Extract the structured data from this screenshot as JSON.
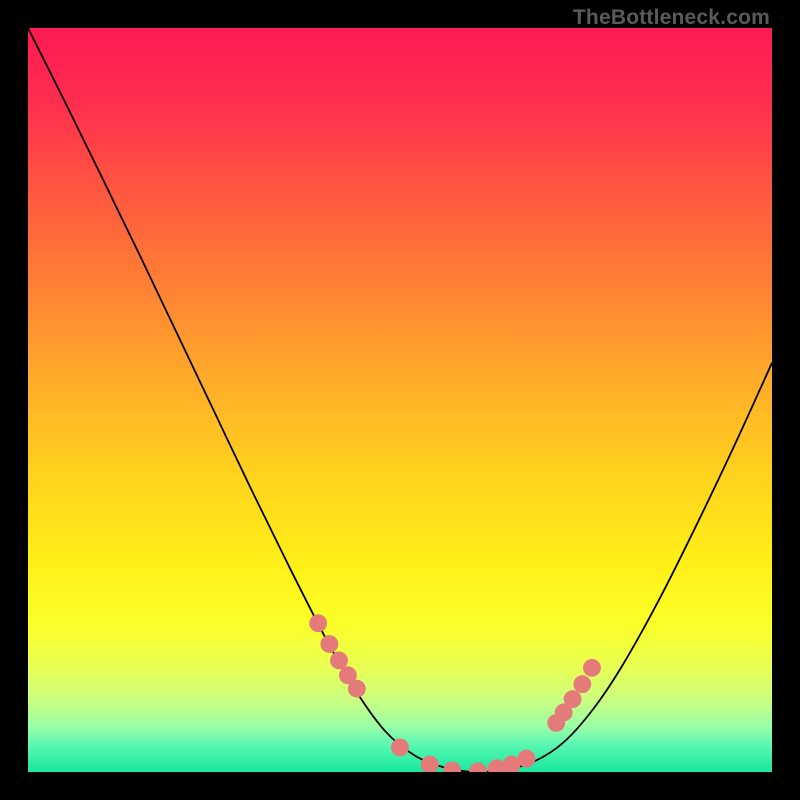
{
  "watermark": "TheBottleneck.com",
  "chart_data": {
    "type": "line",
    "title": "",
    "xlabel": "",
    "ylabel": "",
    "xlim": [
      0,
      1
    ],
    "ylim": [
      0,
      1
    ],
    "background_gradient_stops": [
      {
        "offset": 0.0,
        "color": "#ff1a55"
      },
      {
        "offset": 0.1,
        "color": "#ff2e4e"
      },
      {
        "offset": 0.22,
        "color": "#ff5740"
      },
      {
        "offset": 0.35,
        "color": "#ff8234"
      },
      {
        "offset": 0.48,
        "color": "#ffae28"
      },
      {
        "offset": 0.6,
        "color": "#ffd21e"
      },
      {
        "offset": 0.72,
        "color": "#fff018"
      },
      {
        "offset": 0.8,
        "color": "#fcff28"
      },
      {
        "offset": 0.86,
        "color": "#e8ff54"
      },
      {
        "offset": 0.905,
        "color": "#c8ff82"
      },
      {
        "offset": 0.94,
        "color": "#98ffa8"
      },
      {
        "offset": 0.965,
        "color": "#56f7b2"
      },
      {
        "offset": 1.0,
        "color": "#18e89c"
      }
    ],
    "series": [
      {
        "name": "bottleneck-curve",
        "color": "#000000",
        "x": [
          0.0,
          0.05,
          0.1,
          0.15,
          0.2,
          0.25,
          0.3,
          0.35,
          0.4,
          0.44,
          0.48,
          0.52,
          0.56,
          0.6,
          0.64,
          0.68,
          0.72,
          0.76,
          0.8,
          0.85,
          0.9,
          0.95,
          1.0
        ],
        "y": [
          1.0,
          0.9,
          0.798,
          0.695,
          0.59,
          0.485,
          0.38,
          0.278,
          0.18,
          0.11,
          0.055,
          0.022,
          0.006,
          0.0,
          0.003,
          0.014,
          0.04,
          0.085,
          0.145,
          0.235,
          0.335,
          0.44,
          0.55
        ]
      }
    ],
    "markers": {
      "name": "highlight-dots",
      "color": "#e47a7a",
      "radius_frac": 0.012,
      "x": [
        0.39,
        0.405,
        0.418,
        0.43,
        0.442,
        0.5,
        0.54,
        0.57,
        0.605,
        0.63,
        0.65,
        0.67,
        0.71,
        0.72,
        0.732,
        0.745,
        0.758
      ],
      "y": [
        0.2,
        0.172,
        0.15,
        0.13,
        0.112,
        0.033,
        0.01,
        0.002,
        0.001,
        0.005,
        0.01,
        0.018,
        0.066,
        0.08,
        0.098,
        0.118,
        0.14
      ]
    }
  }
}
